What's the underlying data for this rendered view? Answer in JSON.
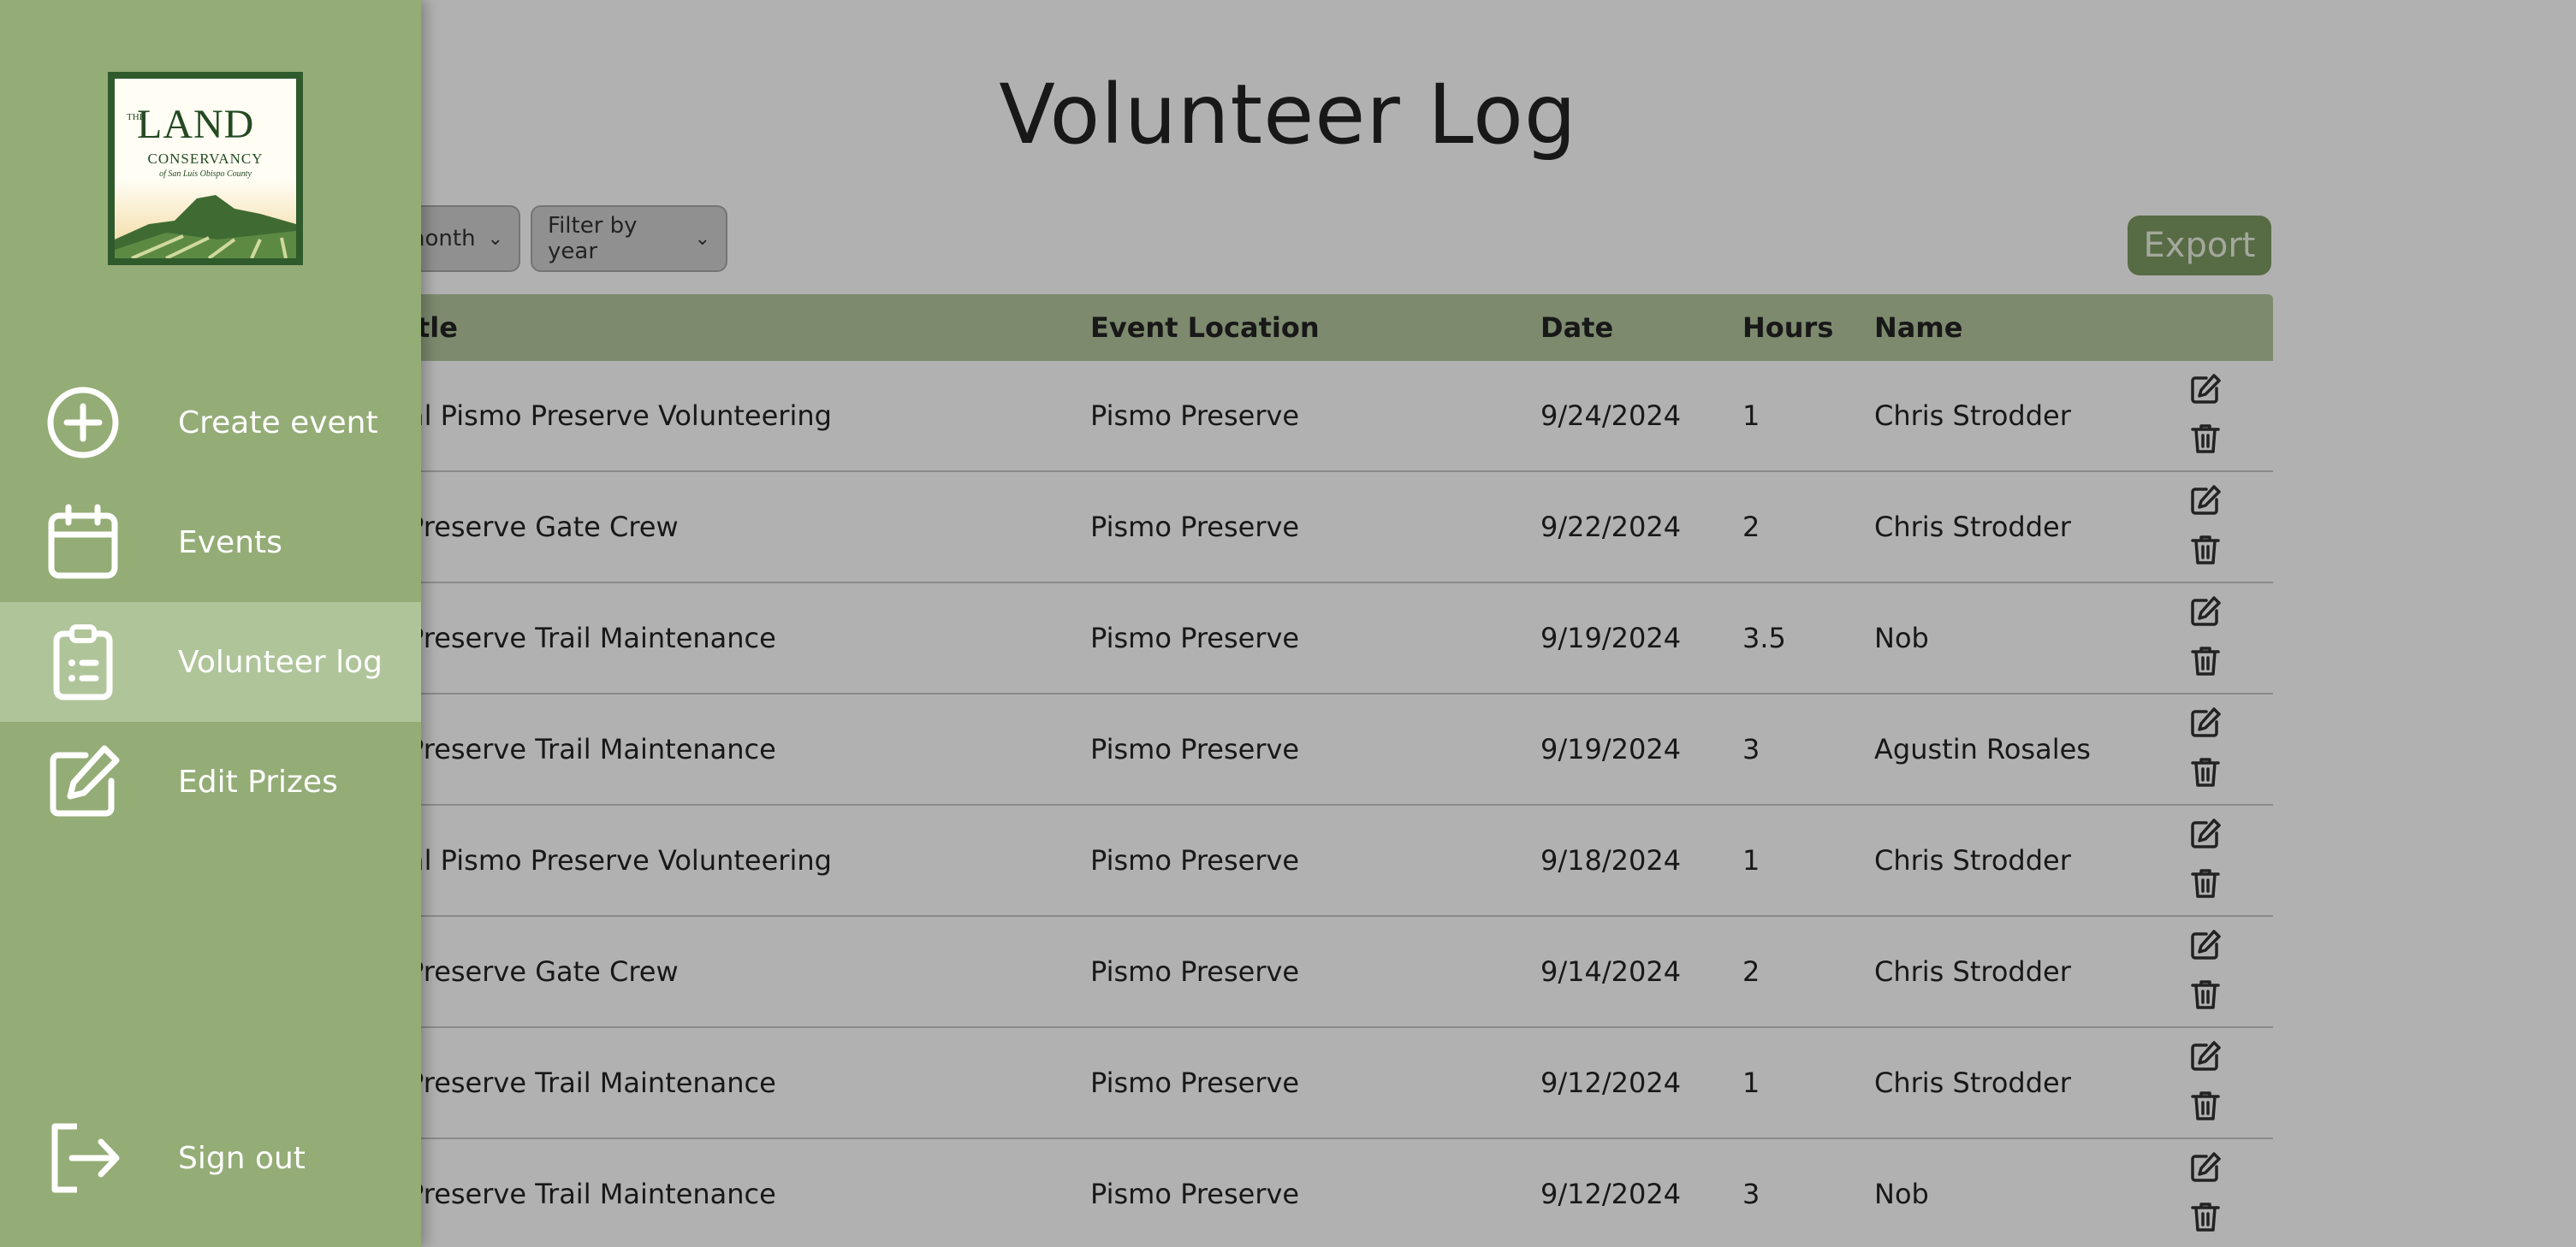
{
  "page": {
    "title": "Volunteer Log"
  },
  "filters": {
    "month_label": "nonth",
    "year_label": "Filter by year"
  },
  "export_label": "Export",
  "table": {
    "headers": [
      "itle",
      "Event Location",
      "Date",
      "Hours",
      "Name"
    ],
    "rows": [
      {
        "title": "al Pismo Preserve Volunteering",
        "location": "Pismo Preserve",
        "date": "9/24/2024",
        "hours": "1",
        "name": "Chris Strodder"
      },
      {
        "title": "Preserve Gate Crew",
        "location": "Pismo Preserve",
        "date": "9/22/2024",
        "hours": "2",
        "name": "Chris Strodder"
      },
      {
        "title": "Preserve Trail Maintenance",
        "location": "Pismo Preserve",
        "date": "9/19/2024",
        "hours": "3.5",
        "name": "Nob"
      },
      {
        "title": "Preserve Trail Maintenance",
        "location": "Pismo Preserve",
        "date": "9/19/2024",
        "hours": "3",
        "name": "Agustin Rosales"
      },
      {
        "title": "al Pismo Preserve Volunteering",
        "location": "Pismo Preserve",
        "date": "9/18/2024",
        "hours": "1",
        "name": "Chris Strodder"
      },
      {
        "title": "Preserve Gate Crew",
        "location": "Pismo Preserve",
        "date": "9/14/2024",
        "hours": "2",
        "name": "Chris Strodder"
      },
      {
        "title": "Preserve Trail Maintenance",
        "location": "Pismo Preserve",
        "date": "9/12/2024",
        "hours": "1",
        "name": "Chris Strodder"
      },
      {
        "title": "Preserve Trail Maintenance",
        "location": "Pismo Preserve",
        "date": "9/12/2024",
        "hours": "3",
        "name": "Nob"
      }
    ]
  },
  "sidebar": {
    "logo": {
      "the": "THE",
      "land": "LAND",
      "conservancy": "CONSERVANCY",
      "county": "of San Luis Obispo County"
    },
    "items": [
      {
        "label": "Create event",
        "icon": "plus-circle-icon"
      },
      {
        "label": "Events",
        "icon": "calendar-icon"
      },
      {
        "label": "Volunteer log",
        "icon": "clipboard-list-icon",
        "active": true
      },
      {
        "label": "Edit Prizes",
        "icon": "edit-icon"
      }
    ],
    "signout": {
      "label": "Sign out",
      "icon": "sign-out-icon"
    }
  },
  "colors": {
    "sidebar_bg": "#94ac76",
    "sidebar_active": "#b0c49a",
    "export_bg": "#6a8a4a",
    "header_bg": "#a9bf8f"
  }
}
